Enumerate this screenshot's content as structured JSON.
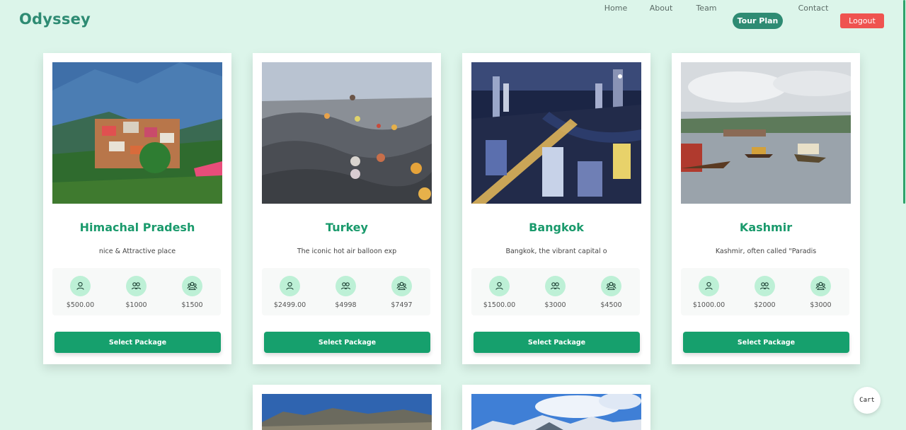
{
  "brand": "Odyssey",
  "nav": {
    "items": [
      {
        "label": "Home",
        "active": false
      },
      {
        "label": "About",
        "active": false
      },
      {
        "label": "Team",
        "active": false
      },
      {
        "label": "Tour Plan",
        "active": true
      },
      {
        "label": "Contact",
        "active": false
      }
    ],
    "logout_label": "Logout"
  },
  "packages": [
    {
      "title": "Himachal Pradesh",
      "description": "nice & Attractive place",
      "prices": [
        "$500.00",
        "$1000",
        "$1500"
      ],
      "button": "Select Package",
      "image": "mountain-village-photo"
    },
    {
      "title": "Turkey",
      "description": "The iconic hot air balloon exp",
      "prices": [
        "$2499.00",
        "$4998",
        "$7497"
      ],
      "button": "Select Package",
      "image": "hot-air-balloons-photo"
    },
    {
      "title": "Bangkok",
      "description": "Bangkok, the vibrant capital o",
      "prices": [
        "$1500.00",
        "$3000",
        "$4500"
      ],
      "button": "Select Package",
      "image": "city-night-photo"
    },
    {
      "title": "Kashmir",
      "description": "Kashmir, often called \"Paradis",
      "prices": [
        "$1000.00",
        "$2000",
        "$3000"
      ],
      "button": "Select Package",
      "image": "lake-boats-photo"
    }
  ],
  "more_packages": [
    {
      "image": "mountain-range-photo"
    },
    {
      "image": "snow-peaks-photo"
    }
  ],
  "price_icons": [
    "single-person-icon",
    "two-people-icon",
    "group-icon"
  ],
  "cart_label": "Cart",
  "colors": {
    "background": "#dcf5ea",
    "brand": "#2e8b73",
    "accent": "#16a06d",
    "logout": "#ef5350",
    "icon_bg": "#bdf0d6"
  }
}
